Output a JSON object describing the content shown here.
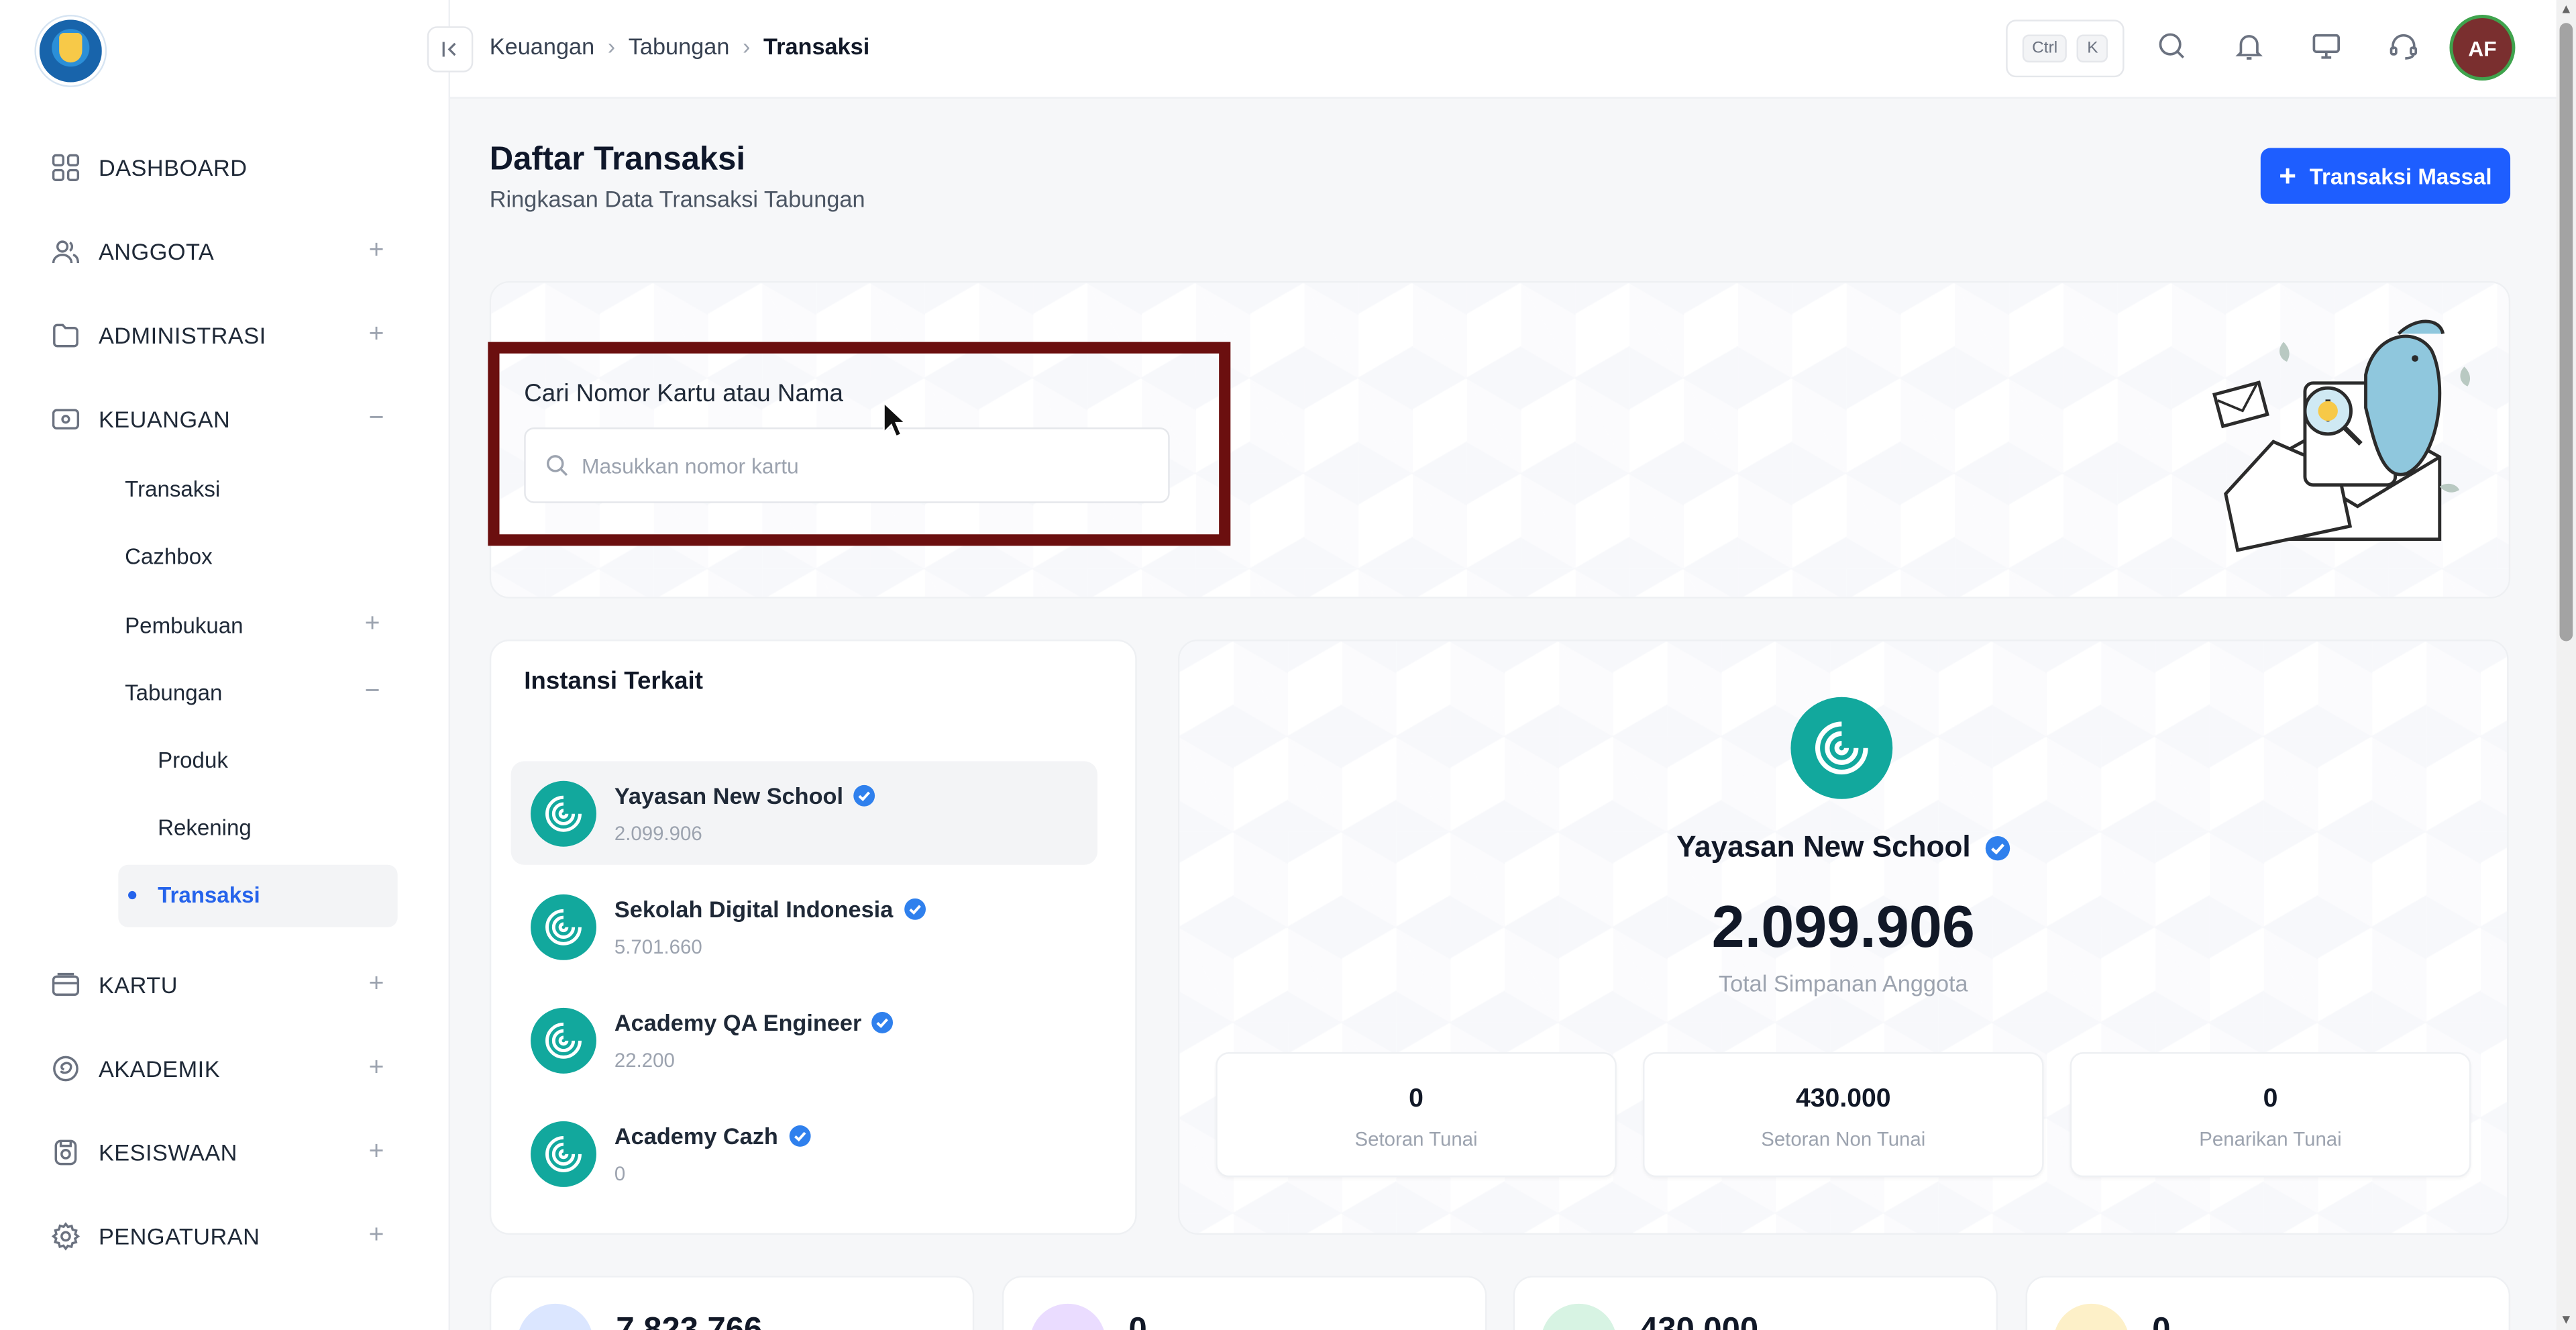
{
  "breadcrumb": {
    "items": [
      "Keuangan",
      "Tabungan",
      "Transaksi"
    ]
  },
  "topbar": {
    "kbd_ctrl": "Ctrl",
    "kbd_k": "K",
    "avatar_initials": "AF"
  },
  "sidebar": {
    "dashboard": "DASHBOARD",
    "anggota": "ANGGOTA",
    "administrasi": "ADMINISTRASI",
    "keuangan": "KEUANGAN",
    "transaksi": "Transaksi",
    "cazhbox": "Cazhbox",
    "pembukuan": "Pembukuan",
    "tabungan": "Tabungan",
    "produk": "Produk",
    "rekening": "Rekening",
    "tabungan_transaksi": "Transaksi",
    "kartu": "KARTU",
    "akademik": "AKADEMIK",
    "kesiswaan": "KESISWAAN",
    "pengaturan": "PENGATURAN",
    "plus": "+",
    "minus": "−"
  },
  "page": {
    "title": "Daftar Transaksi",
    "subtitle": "Ringkasan Data Transaksi Tabungan",
    "primary_button": "Transaksi Massal"
  },
  "search": {
    "label": "Cari Nomor Kartu atau Nama",
    "placeholder": "Masukkan nomor kartu"
  },
  "institutions": {
    "title": "Instansi Terkait",
    "items": [
      {
        "name": "Yayasan New School",
        "value": "2.099.906"
      },
      {
        "name": "Sekolah Digital Indonesia",
        "value": "5.701.660"
      },
      {
        "name": "Academy QA Engineer",
        "value": "22.200"
      },
      {
        "name": "Academy Cazh",
        "value": "0"
      }
    ]
  },
  "detail": {
    "name": "Yayasan New School",
    "amount": "2.099.906",
    "caption": "Total Simpanan Anggota",
    "stats": [
      {
        "value": "0",
        "label": "Setoran Tunai"
      },
      {
        "value": "430.000",
        "label": "Setoran Non Tunai"
      },
      {
        "value": "0",
        "label": "Penarikan Tunai"
      }
    ]
  },
  "bottom_cards": [
    {
      "value": "7.823.766"
    },
    {
      "value": "0"
    },
    {
      "value": "430.000"
    },
    {
      "value": "0"
    }
  ],
  "colors": {
    "accent": "#1e5eff",
    "teal": "#12a89d",
    "highlight_frame": "#6b0f0f",
    "verify_blue": "#2f80ed"
  },
  "icons": {
    "dashboard": "grid-icon",
    "anggota": "users-icon",
    "administrasi": "folder-icon",
    "keuangan": "wallet-icon",
    "kartu": "card-icon",
    "akademik": "academic-icon",
    "kesiswaan": "student-icon",
    "pengaturan": "gear-icon"
  }
}
